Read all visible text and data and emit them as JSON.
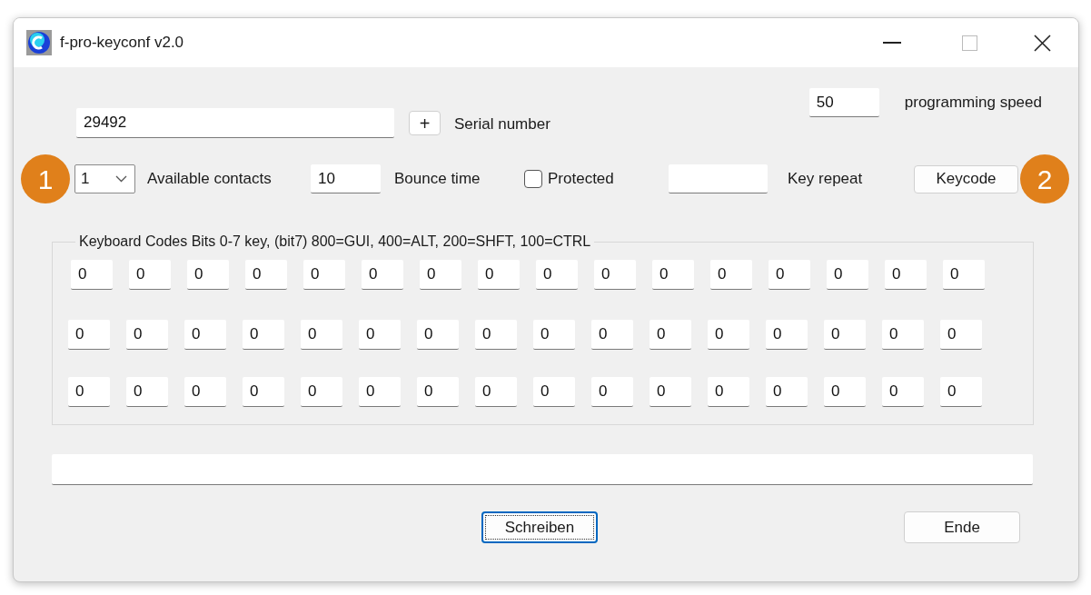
{
  "window": {
    "title": "f-pro-keyconf v2.0"
  },
  "programming_speed": {
    "value": "50",
    "label": "programming speed"
  },
  "serial_number": {
    "value": "29492",
    "plus": "+",
    "label": "Serial number"
  },
  "callouts": [
    "1",
    "2"
  ],
  "available_contacts": {
    "value": "1",
    "label": "Available contacts"
  },
  "bounce_time": {
    "value": "10",
    "label": "Bounce time"
  },
  "protected": {
    "label": "Protected",
    "checked": false
  },
  "key_repeat": {
    "label": "Key repeat"
  },
  "keycode_button": "Keycode",
  "keyboard_codes": {
    "legend": "Keyboard Codes Bits 0-7 key, (bit7)  800=GUI, 400=ALT, 200=SHFT, 100=CTRL",
    "rows": [
      [
        "0",
        "0",
        "0",
        "0",
        "0",
        "0",
        "0",
        "0",
        "0",
        "0",
        "0",
        "0",
        "0",
        "0",
        "0",
        "0"
      ],
      [
        "0",
        "0",
        "0",
        "0",
        "0",
        "0",
        "0",
        "0",
        "0",
        "0",
        "0",
        "0",
        "0",
        "0",
        "0",
        "0"
      ],
      [
        "0",
        "0",
        "0",
        "0",
        "0",
        "0",
        "0",
        "0",
        "0",
        "0",
        "0",
        "0",
        "0",
        "0",
        "0",
        "0"
      ]
    ]
  },
  "buttons": [
    {
      "label": "Schreiben",
      "focused": true
    },
    {
      "label": "Ende",
      "focused": false
    }
  ]
}
